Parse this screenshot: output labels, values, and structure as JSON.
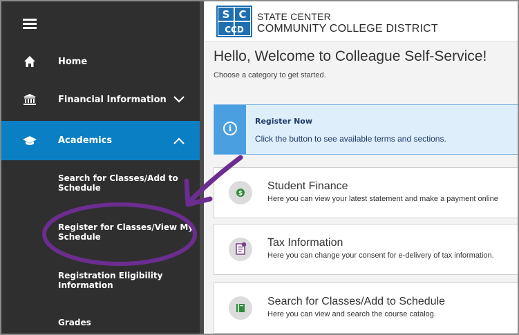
{
  "sidebar": {
    "menu_icon": "hamburger-menu-icon",
    "items": [
      {
        "label": "Home",
        "icon": "home-icon"
      },
      {
        "label": "Financial Information",
        "icon": "bank-icon"
      },
      {
        "label": "Academics",
        "icon": "graduation-cap-icon",
        "expanded": true
      }
    ],
    "academics_subitems": [
      "Search for Classes/Add to Schedule",
      "Register for Classes/View My Schedule",
      "Registration Eligibility Information",
      "Grades"
    ]
  },
  "header": {
    "logo_text": "SC CCD",
    "brand_line1": "STATE CENTER",
    "brand_line2": "COMMUNITY COLLEGE DISTRICT"
  },
  "main": {
    "welcome": "Hello, Welcome to Colleague Self-Service!",
    "subtitle": "Choose a category to get started.",
    "register_notice": {
      "title": "Register Now",
      "description": "Click the button to see available terms and sections.",
      "icon": "info-icon"
    },
    "cards": [
      {
        "title": "Student Finance",
        "description": "Here you can view your latest statement and make a payment online",
        "icon": "money-icon"
      },
      {
        "title": "Tax Information",
        "description": "Here you can change your consent for e-delivery of tax information.",
        "icon": "tax-document-icon"
      },
      {
        "title": "Search for Classes/Add to Schedule",
        "description": "Here you can view and search the course catalog.",
        "icon": "catalog-book-icon"
      }
    ]
  },
  "colors": {
    "sidebar_bg": "#2f2f2f",
    "active_item": "#0b7fc3",
    "notice_bg": "#dfeefb",
    "notice_accent": "#4a9fe0",
    "annotation": "#6b2d8f",
    "finance_icon": "#2e8b3e",
    "tax_icon": "#7a3f8a"
  }
}
